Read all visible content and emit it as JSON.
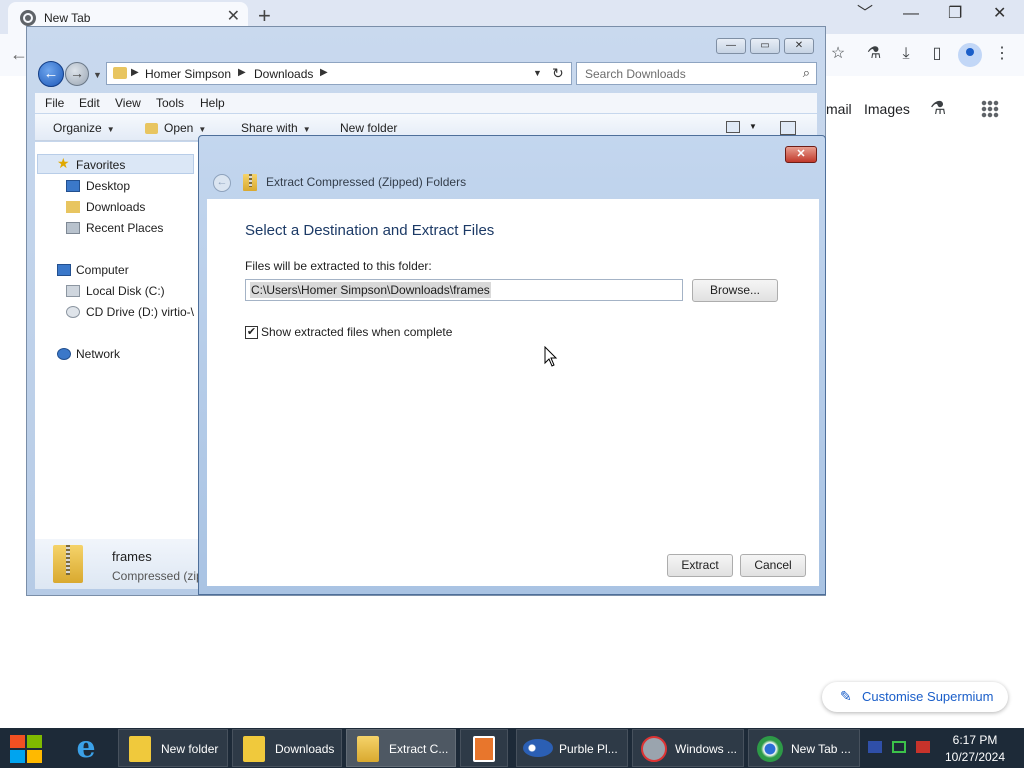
{
  "browser": {
    "tab_title": "New Tab",
    "tab_close": "✕",
    "new_tab": "+",
    "window_controls": [
      "﹀",
      "—",
      "❐",
      "✕"
    ],
    "links": [
      "mail",
      "Images"
    ],
    "customise_label": "Customise Supermium"
  },
  "explorer": {
    "window_buttons": [
      "—",
      "▭",
      "✕"
    ],
    "breadcrumb": [
      "Homer Simpson",
      "Downloads"
    ],
    "search_placeholder": "Search Downloads",
    "menu": [
      "File",
      "Edit",
      "View",
      "Tools",
      "Help"
    ],
    "commands": {
      "organize": "Organize",
      "open": "Open",
      "share_with": "Share with",
      "new_folder": "New folder"
    },
    "nav": {
      "favorites": "Favorites",
      "desktop": "Desktop",
      "downloads": "Downloads",
      "recent_places": "Recent Places",
      "computer": "Computer",
      "local_disk": "Local Disk (C:)",
      "cd_drive": "CD Drive (D:) virtio-\\",
      "network": "Network"
    },
    "details": {
      "name": "frames",
      "type": "Compressed (zip"
    }
  },
  "dialog": {
    "title": "Extract Compressed (Zipped) Folders",
    "close": "✕",
    "heading": "Select a Destination and Extract Files",
    "destination_label": "Files will be extracted to this folder:",
    "destination_value": "C:\\Users\\Homer Simpson\\Downloads\\frames",
    "browse_label": "Browse...",
    "show_files_label": "Show extracted files when complete",
    "show_files_checked": true,
    "extract_label": "Extract",
    "cancel_label": "Cancel"
  },
  "taskbar": {
    "items": [
      {
        "label": "New folder",
        "icon": "folder-icon"
      },
      {
        "label": "Downloads",
        "icon": "downloads-folder-icon"
      },
      {
        "label": "Extract C...",
        "icon": "zip-folder-icon"
      },
      {
        "label": "",
        "icon": "media-player-icon"
      },
      {
        "label": "Purble Pl...",
        "icon": "purble-place-icon"
      },
      {
        "label": "Windows ...",
        "icon": "windows-media-icon"
      },
      {
        "label": "New Tab ...",
        "icon": "supermium-icon"
      }
    ],
    "time": "6:17 PM",
    "date": "10/27/2024"
  }
}
